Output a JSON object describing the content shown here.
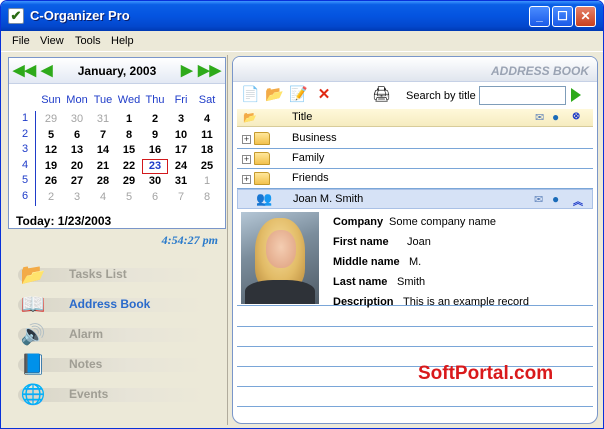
{
  "window": {
    "title": "C-Organizer Pro"
  },
  "menu": {
    "file": "File",
    "view": "View",
    "tools": "Tools",
    "help": "Help"
  },
  "calendar": {
    "month": "January, 2003",
    "dow": [
      "Sun",
      "Mon",
      "Tue",
      "Wed",
      "Thu",
      "Fri",
      "Sat"
    ],
    "weeks": [
      "1",
      "2",
      "3",
      "4",
      "5",
      "6"
    ],
    "days": [
      [
        "29",
        "30",
        "31",
        "1",
        "2",
        "3",
        "4"
      ],
      [
        "5",
        "6",
        "7",
        "8",
        "9",
        "10",
        "11"
      ],
      [
        "12",
        "13",
        "14",
        "15",
        "16",
        "17",
        "18"
      ],
      [
        "19",
        "20",
        "21",
        "22",
        "23",
        "24",
        "25"
      ],
      [
        "26",
        "27",
        "28",
        "29",
        "30",
        "31",
        "1"
      ],
      [
        "2",
        "3",
        "4",
        "5",
        "6",
        "7",
        "8"
      ]
    ],
    "today": "Today: 1/23/2003"
  },
  "clock": "4:54:27 pm",
  "nav": {
    "tasks": "Tasks List",
    "address": "Address Book",
    "alarm": "Alarm",
    "notes": "Notes",
    "events": "Events"
  },
  "address_book": {
    "header": "ADDRESS BOOK",
    "search_label": "Search by title",
    "search_value": "",
    "column_title": "Title",
    "groups": [
      "Business",
      "Family",
      "Friends"
    ],
    "contact": {
      "name": "Joan M. Smith",
      "fields": [
        {
          "key": "Company",
          "value": "Some company name"
        },
        {
          "key": "First name",
          "value": "Joan"
        },
        {
          "key": "Middle name",
          "value": "M."
        },
        {
          "key": "Last name",
          "value": "Smith"
        },
        {
          "key": "Description",
          "value": "This is an example record"
        }
      ]
    }
  },
  "watermark": "SoftPortal.com",
  "colors": {
    "accent": "#2a6acb",
    "today_border": "#d2191c",
    "watermark": "#d9191b"
  }
}
